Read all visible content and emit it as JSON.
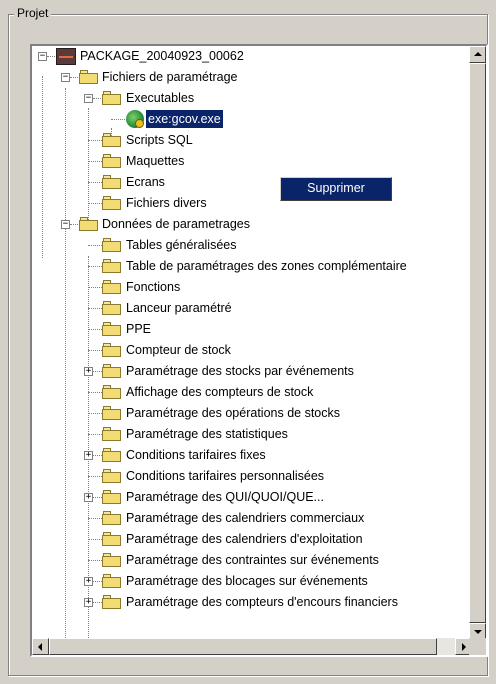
{
  "group": {
    "title": "Projet"
  },
  "tree": {
    "root": "PACKAGE_20040923_00062",
    "fichiers": "Fichiers de paramétrage",
    "executables": "Executables",
    "exe_file": "exe:gcov.exe",
    "scripts_sql": "Scripts SQL",
    "maquettes": "Maquettes",
    "ecrans": "Ecrans",
    "fichiers_divers": "Fichiers divers",
    "donnees": "Données de parametrages",
    "items": [
      "Tables généralisées",
      "Table de paramétrages des zones complémentaire",
      "Fonctions",
      "Lanceur paramétré",
      "PPE",
      "Compteur de stock",
      "Paramétrage des stocks par événements",
      "Affichage des compteurs de stock",
      "Paramétrage des opérations de stocks",
      "Paramétrage des statistiques",
      "Conditions tarifaires fixes",
      "Conditions tarifaires personnalisées",
      "Paramétrage des QUI/QUOI/QUE...",
      "Paramétrage des calendriers commerciaux",
      "Paramétrage des calendriers d'exploitation",
      "Paramétrage des contraintes sur événements",
      "Paramétrage des blocages sur événements",
      "Paramétrage des compteurs d'encours financiers"
    ]
  },
  "context_menu": {
    "delete_label": "Supprimer"
  }
}
